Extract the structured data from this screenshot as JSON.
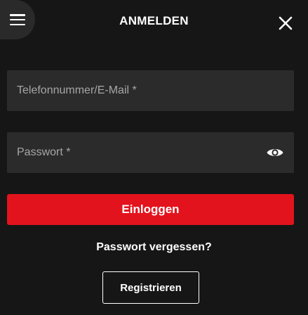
{
  "header": {
    "title": "ANMELDEN",
    "menu_icon": "hamburger-menu-icon",
    "close_icon": "close-icon"
  },
  "form": {
    "phone_email_placeholder": "Telefonnummer/E-Mail *",
    "phone_email_value": "",
    "password_placeholder": "Passwort *",
    "password_value": "",
    "password_toggle_icon": "eye-icon"
  },
  "actions": {
    "login_label": "Einloggen",
    "forgot_password_label": "Passwort vergessen?",
    "register_label": "Registrieren"
  },
  "colors": {
    "background": "#161616",
    "field_background": "#2b2b2b",
    "primary_button": "#e3131d",
    "text": "#ffffff",
    "placeholder": "#a6a6a6"
  }
}
